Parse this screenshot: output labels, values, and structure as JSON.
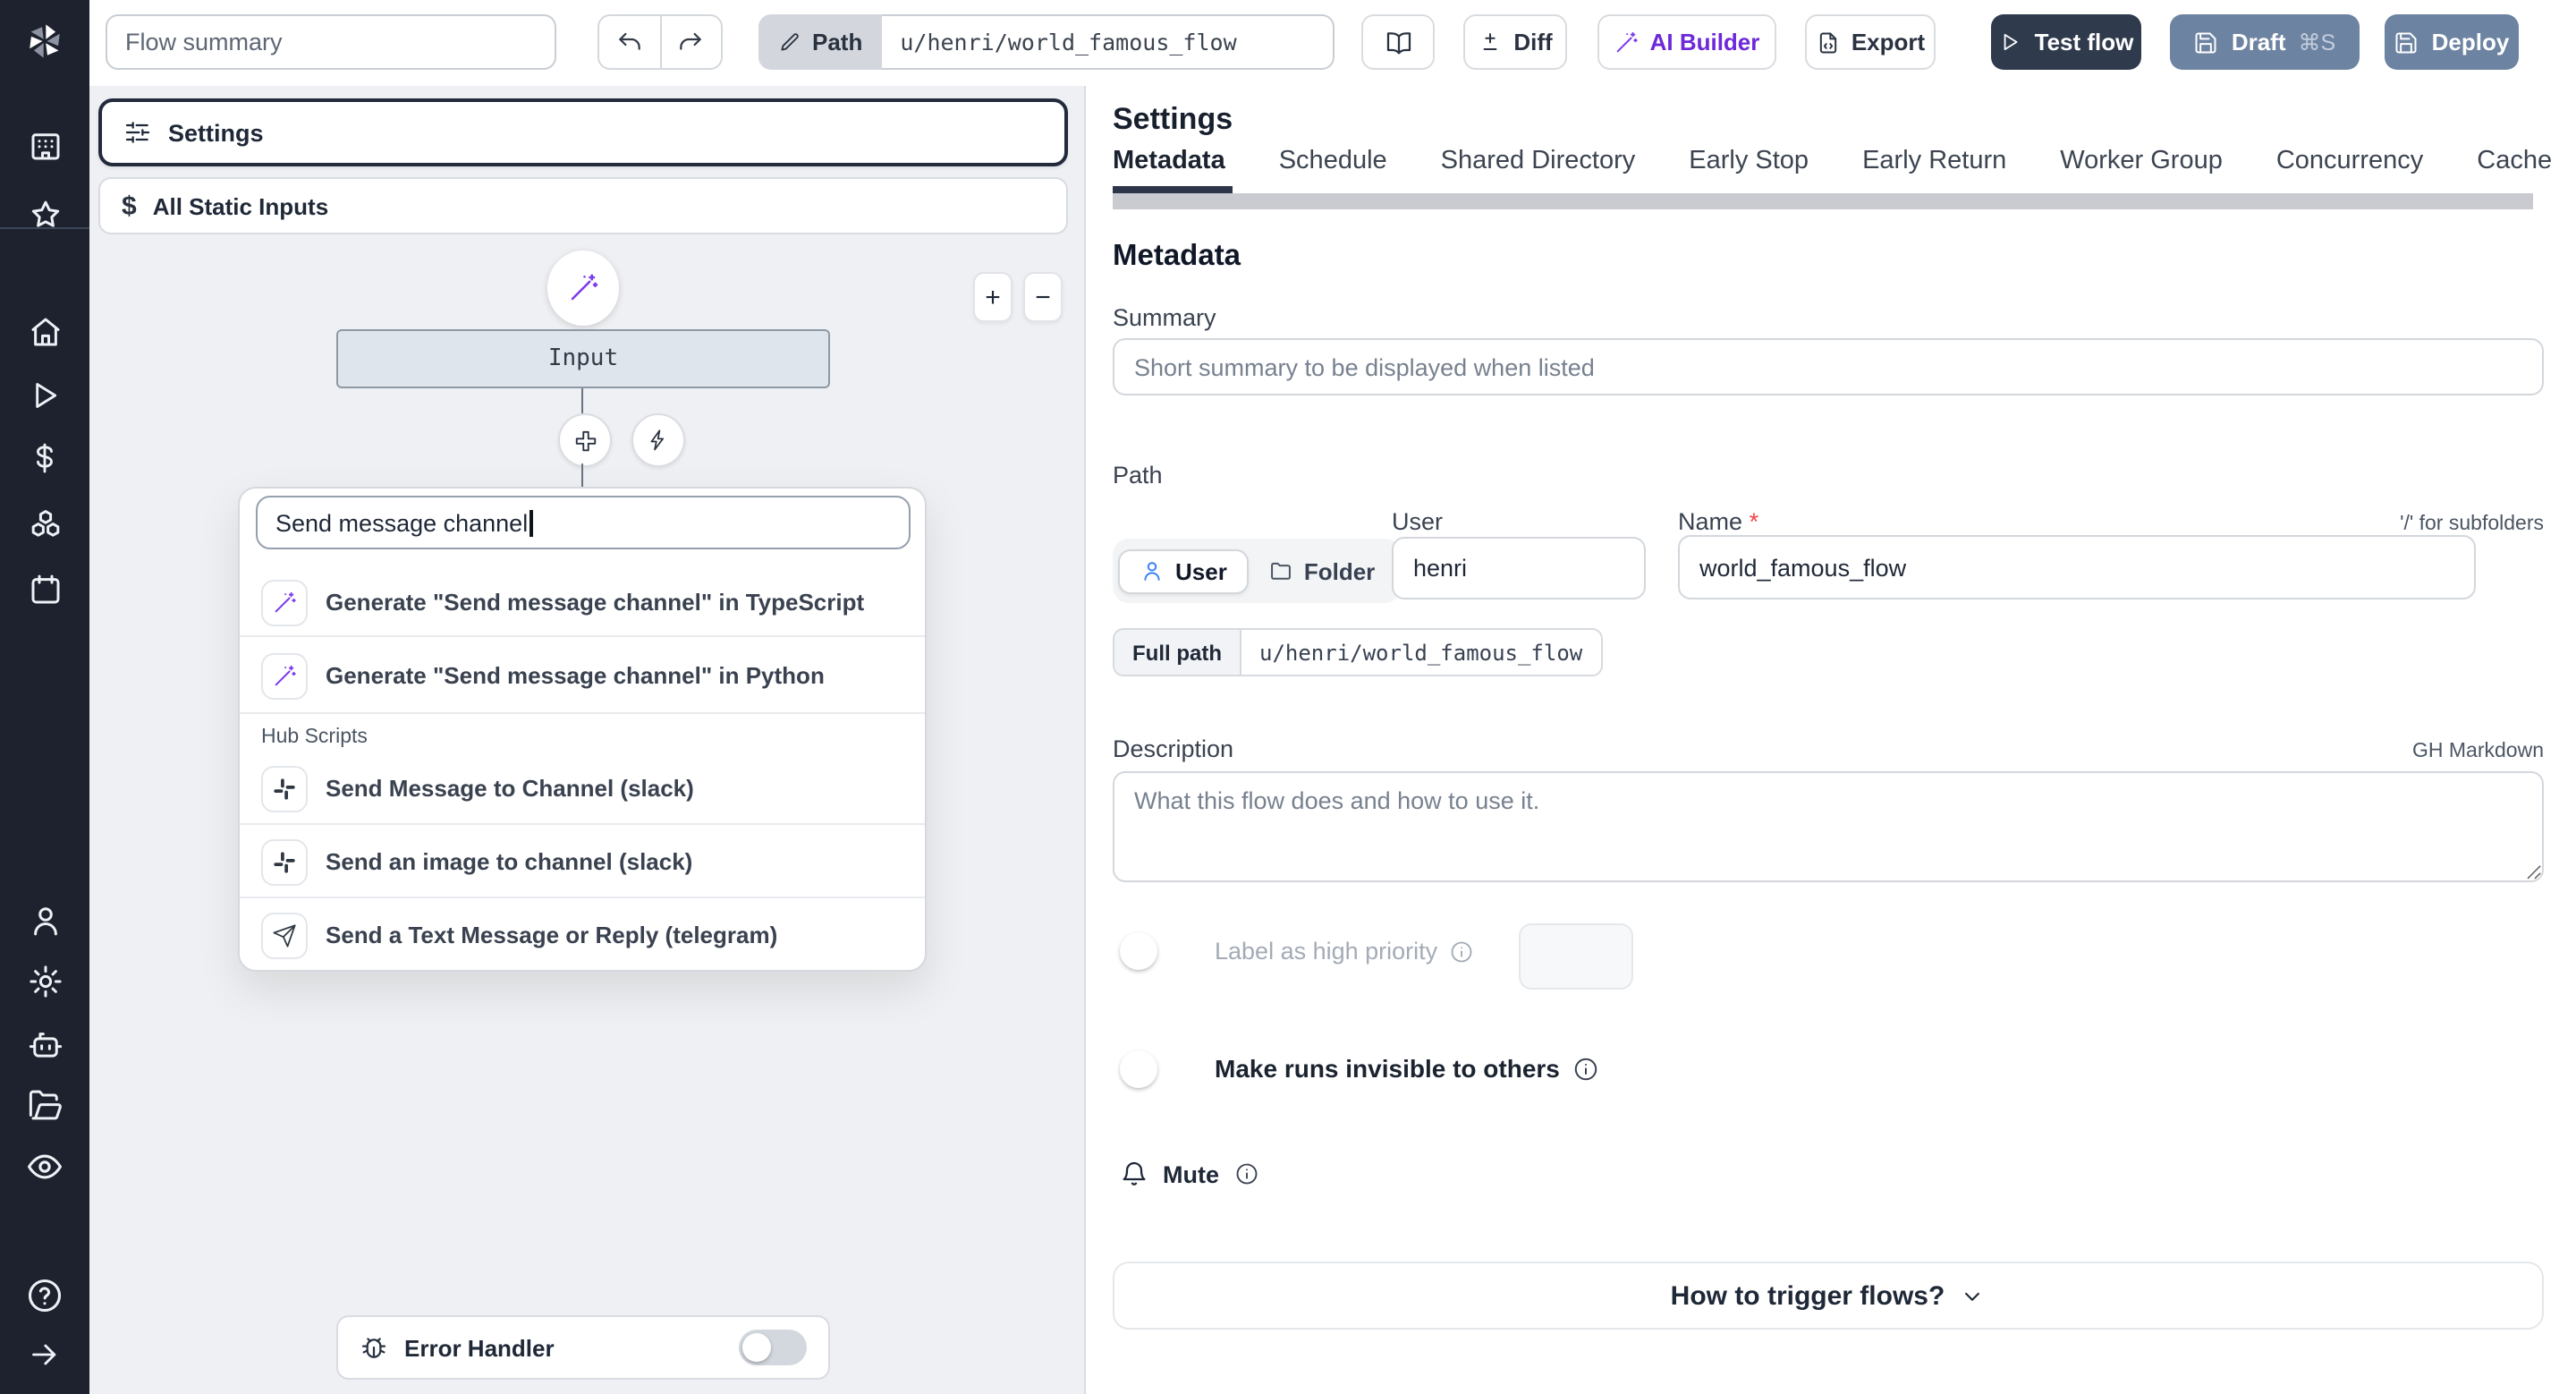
{
  "topbar": {
    "summary_value": "Flow summary",
    "path_label": "Path",
    "path_value": "u/henri/world_famous_flow",
    "diff_label": "Diff",
    "ai_builder_label": "AI Builder",
    "export_label": "Export",
    "test_flow_label": "Test flow",
    "draft_label": "Draft",
    "draft_shortcut": "⌘S",
    "deploy_label": "Deploy"
  },
  "canvas": {
    "settings_label": "Settings",
    "static_inputs_label": "All Static Inputs",
    "dollar_glyph": "$",
    "input_node_label": "Input",
    "zoom_in": "+",
    "zoom_out": "−",
    "search_value": "Send message channel",
    "suggestions": {
      "typescript": "Generate \"Send message channel\" in TypeScript",
      "python": "Generate \"Send message channel\" in Python"
    },
    "hub_header": "Hub Scripts",
    "hub_items": [
      "Send Message to Channel (slack)",
      "Send an image to channel (slack)",
      "Send a Text Message or Reply (telegram)"
    ],
    "error_handler_label": "Error Handler"
  },
  "panel": {
    "title": "Settings",
    "tabs": [
      "Metadata",
      "Schedule",
      "Shared Directory",
      "Early Stop",
      "Early Return",
      "Worker Group",
      "Concurrency",
      "Cache"
    ],
    "metadata": {
      "heading": "Metadata",
      "summary_label": "Summary",
      "summary_placeholder": "Short summary to be displayed when listed",
      "path_label": "Path",
      "owner_kind_user": "User",
      "owner_kind_folder": "Folder",
      "user_label": "User",
      "user_value": "henri",
      "name_label": "Name",
      "required_mark": "*",
      "subfolders_hint": "'/' for subfolders",
      "name_value": "world_famous_flow",
      "full_path_label": "Full path",
      "full_path_value": "u/henri/world_famous_flow",
      "description_label": "Description",
      "markdown_hint": "GH Markdown",
      "description_placeholder": "What this flow does and how to use it.",
      "high_priority_label": "Label as high priority",
      "invisible_label": "Make runs invisible to others",
      "mute_label": "Mute",
      "trigger_help_label": "How to trigger flows?"
    }
  },
  "colors": {
    "accent_purple": "#7c3aed",
    "slate_button": "#6d83a2",
    "dark_button": "#2f3a4d",
    "sidebar_bg": "#1d222e"
  }
}
